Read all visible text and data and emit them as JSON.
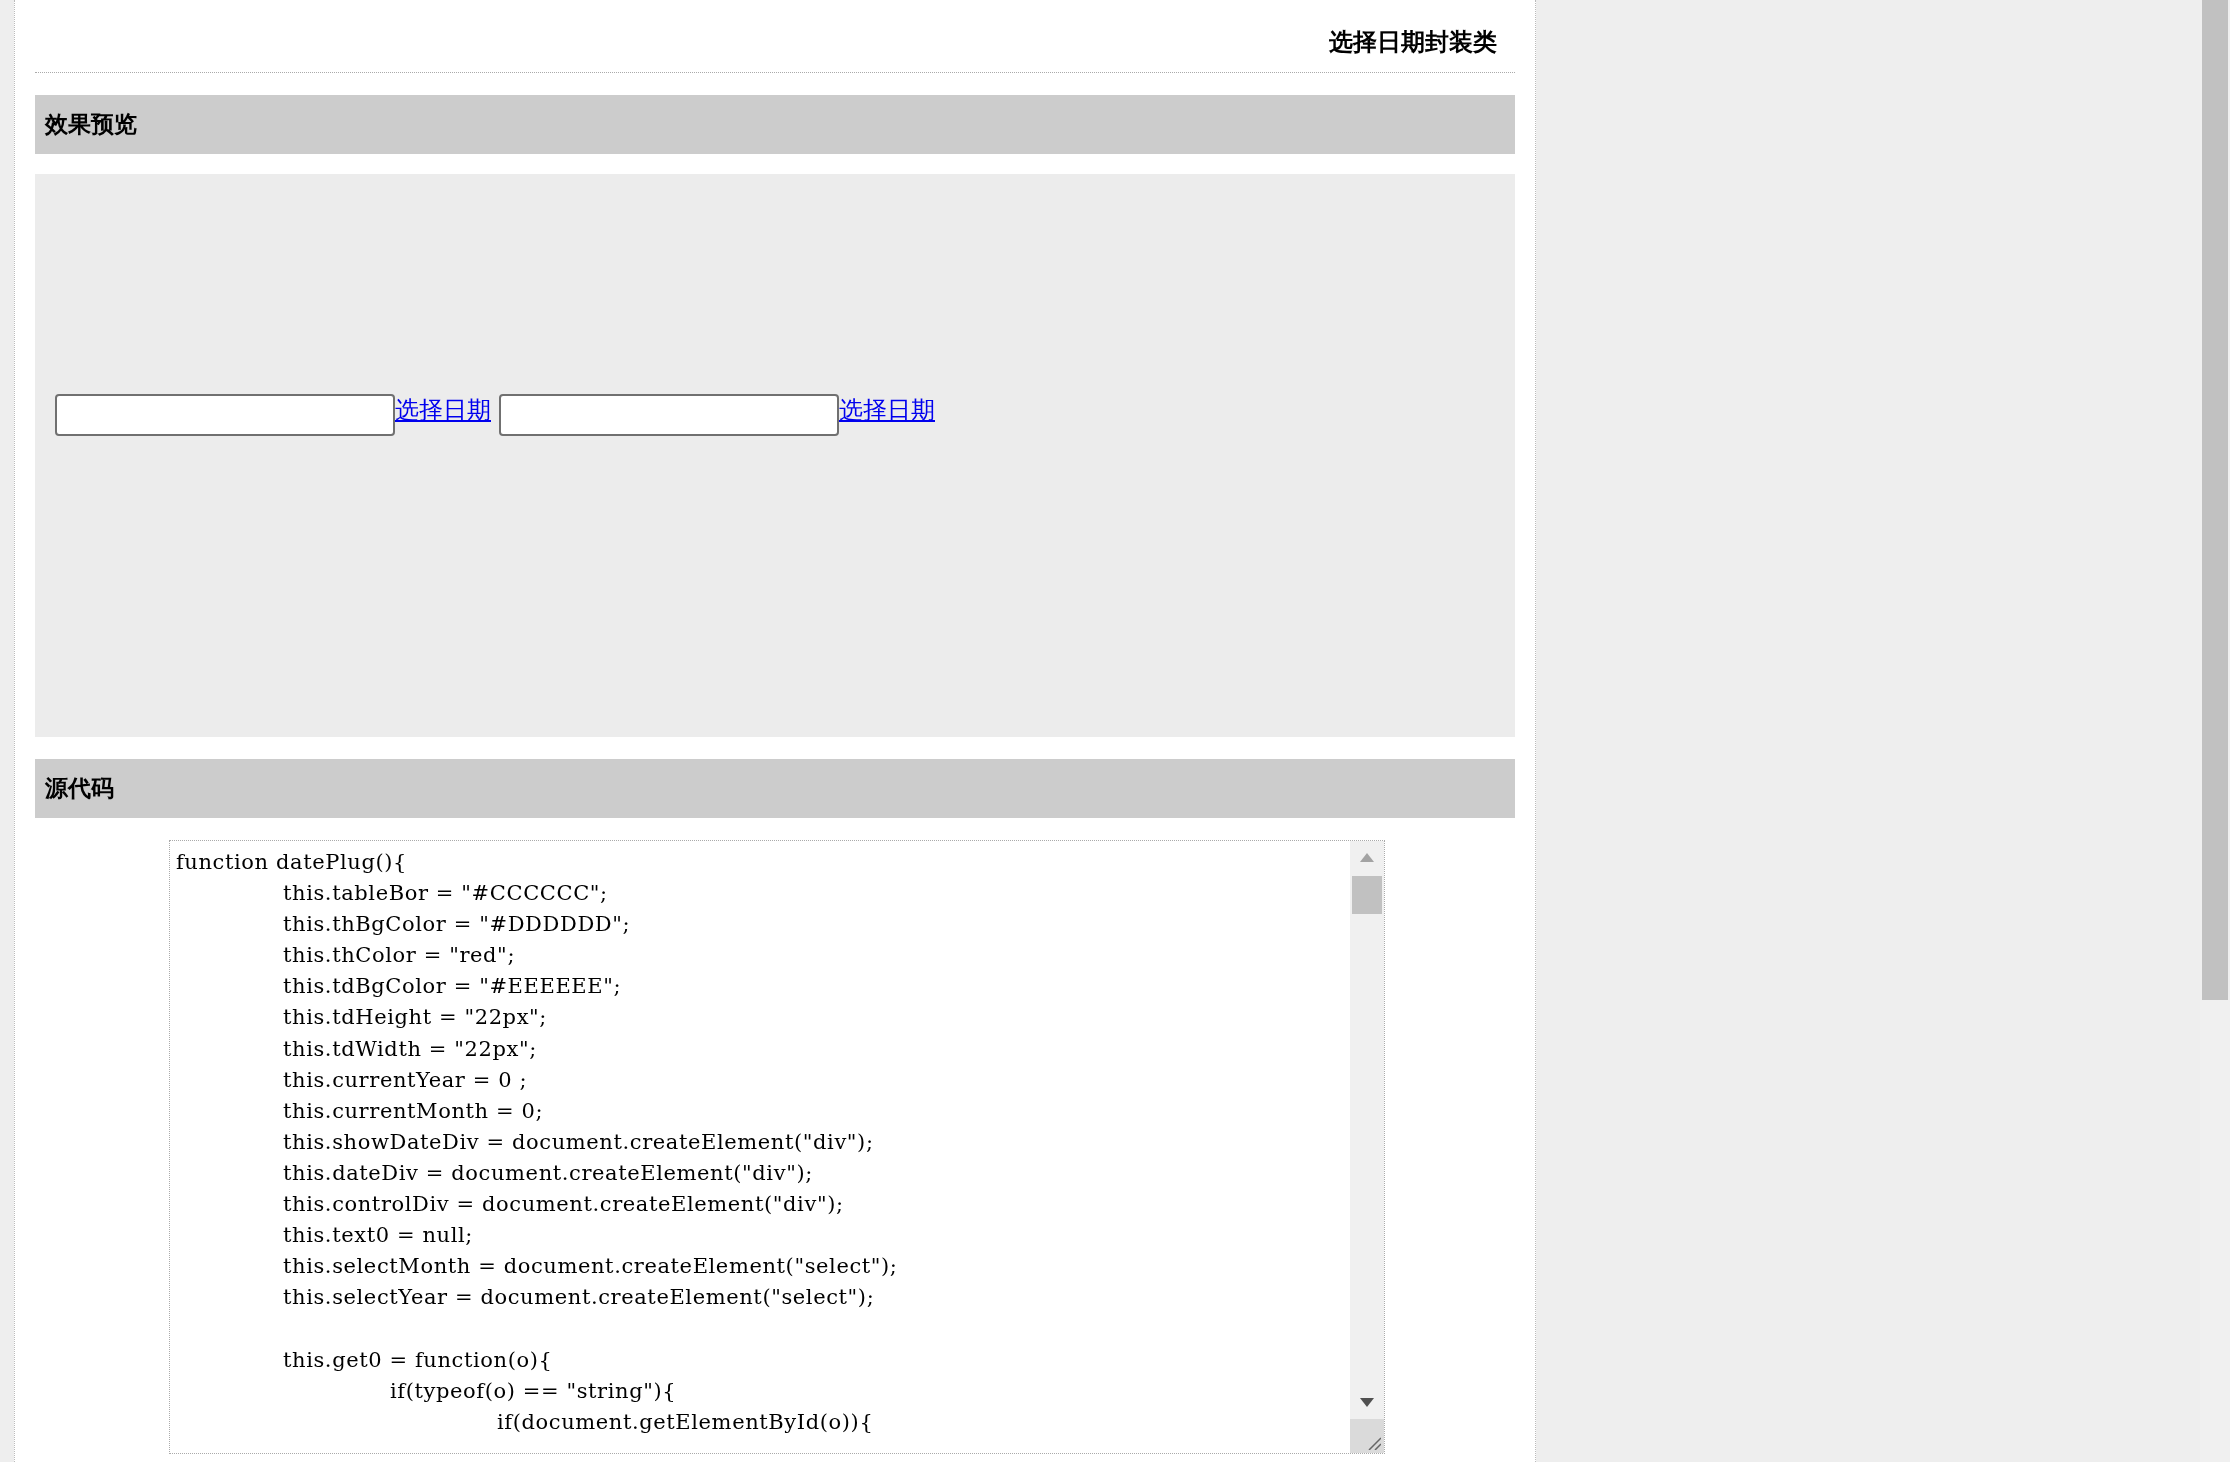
{
  "page_title": "选择日期封装类",
  "preview": {
    "heading": "效果预览",
    "fields": [
      {
        "link": "选择日期"
      },
      {
        "link": "选择日期"
      }
    ]
  },
  "source": {
    "heading": "源代码",
    "code": "function datePlug(){\n\tthis.tableBor = \"#CCCCCC\";\n\tthis.thBgColor = \"#DDDDDD\";\n\tthis.thColor = \"red\";\n\tthis.tdBgColor = \"#EEEEEE\";\n\tthis.tdHeight = \"22px\";\n\tthis.tdWidth = \"22px\";\n\tthis.currentYear = 0 ;\n\tthis.currentMonth = 0;\n\tthis.showDateDiv = document.createElement(\"div\");\n\tthis.dateDiv = document.createElement(\"div\");\n\tthis.controlDiv = document.createElement(\"div\");\n\tthis.text0 = null;\n\tthis.selectMonth = document.createElement(\"select\");\n\tthis.selectYear = document.createElement(\"select\");\n\n\tthis.get0 = function(o){\n\t\tif(typeof(o) == \"string\"){\n\t\t\tif(document.getElementById(o)){"
  }
}
